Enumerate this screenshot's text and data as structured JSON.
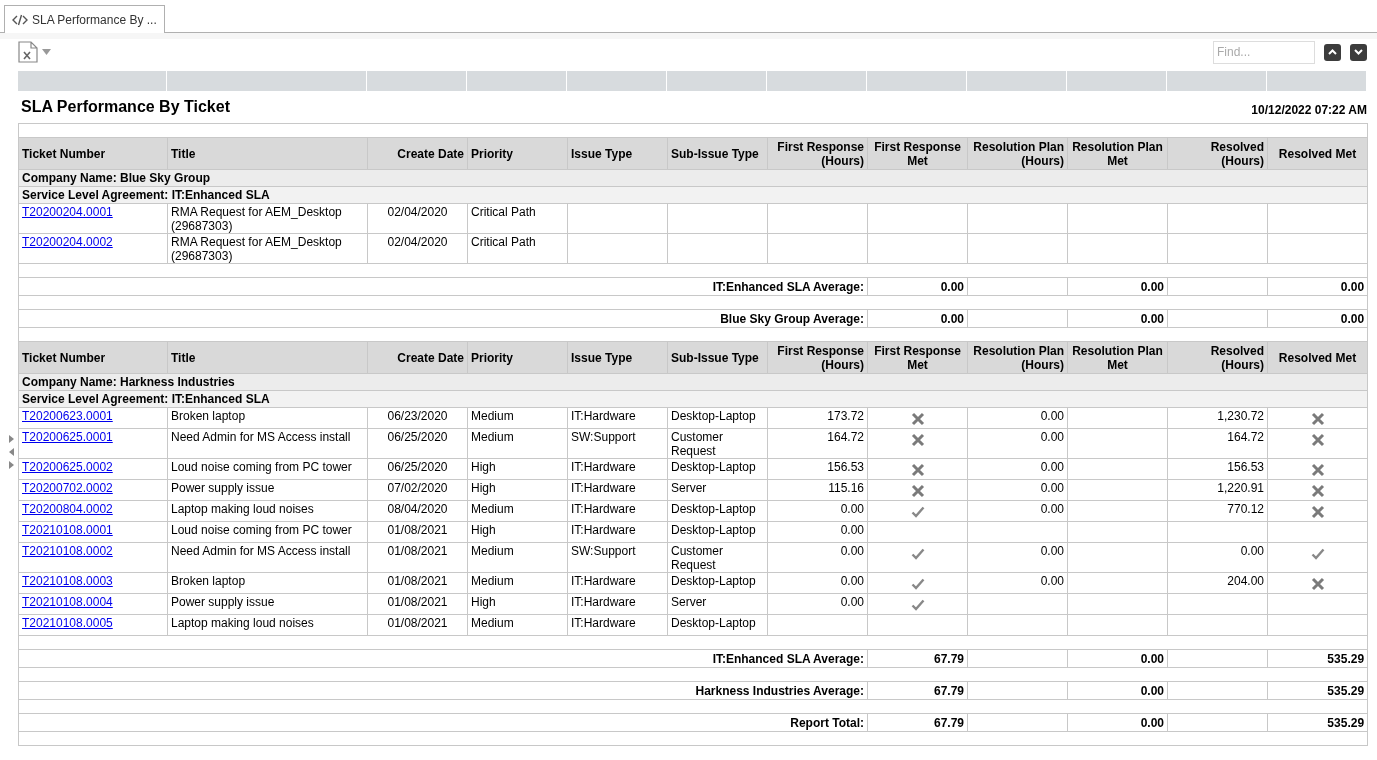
{
  "tab": {
    "label": "SLA Performance By ...",
    "selected": true
  },
  "find": {
    "placeholder": "Find..."
  },
  "report": {
    "title": "SLA Performance By Ticket",
    "timestamp": "10/12/2022 07:22 AM"
  },
  "sections": [
    {
      "columns": [
        "Ticket Number",
        "Title",
        "Create Date",
        "Priority",
        "Issue Type",
        "Sub-Issue Type",
        "First Response\n(Hours)",
        "First Response\nMet",
        "Resolution Plan\n(Hours)",
        "Resolution Plan\nMet",
        "Resolved\n(Hours)",
        "Resolved Met"
      ],
      "company": "Company Name: Blue Sky Group",
      "sla": "Service Level Agreement: IT:Enhanced SLA",
      "tickets": [
        {
          "number": "T20200204.0001",
          "title": "RMA Request for AEM_Desktop (29687303)",
          "date": "02/04/2020",
          "priority": "Critical Path"
        },
        {
          "number": "T20200204.0002",
          "title": "RMA Request for AEM_Desktop (29687303)",
          "date": "02/04/2020",
          "priority": "Critical Path"
        }
      ],
      "averages": [
        {
          "label": "IT:Enhanced SLA Average:",
          "first_response": "0.00",
          "resolution_plan": "0.00",
          "resolved": "0.00"
        },
        {
          "label": "Blue Sky Group Average:",
          "first_response": "0.00",
          "resolution_plan": "0.00",
          "resolved": "0.00"
        }
      ]
    },
    {
      "columns": [
        "Ticket Number",
        "Title",
        "Create Date",
        "Priority",
        "Issue Type",
        "Sub-Issue Type",
        "First Response\n(Hours)",
        "First Response\nMet",
        "Resolution Plan\n(Hours)",
        "Resolution Plan\nMet",
        "Resolved\n(Hours)",
        "Resolved Met"
      ],
      "company": "Company Name: Harkness Industries",
      "sla": "Service Level Agreement: IT:Enhanced SLA",
      "tickets": [
        {
          "number": "T20200623.0001",
          "title": "Broken laptop",
          "date": "06/23/2020",
          "priority": "Medium",
          "issue_type": "IT:Hardware",
          "sub_issue_type": "Desktop-Laptop",
          "first_response": "173.72",
          "first_response_met": false,
          "resolution_plan": "0.00",
          "resolved": "1,230.72",
          "resolved_met": false
        },
        {
          "number": "T20200625.0001",
          "title": "Need Admin for MS Access install",
          "date": "06/25/2020",
          "priority": "Medium",
          "issue_type": "SW:Support",
          "sub_issue_type": "Customer Request",
          "first_response": "164.72",
          "first_response_met": false,
          "resolution_plan": "0.00",
          "resolved": "164.72",
          "resolved_met": false
        },
        {
          "number": "T20200625.0002",
          "title": "Loud noise coming from PC tower",
          "date": "06/25/2020",
          "priority": "High",
          "issue_type": "IT:Hardware",
          "sub_issue_type": "Desktop-Laptop",
          "first_response": "156.53",
          "first_response_met": false,
          "resolution_plan": "0.00",
          "resolved": "156.53",
          "resolved_met": false
        },
        {
          "number": "T20200702.0002",
          "title": "Power supply issue",
          "date": "07/02/2020",
          "priority": "High",
          "issue_type": "IT:Hardware",
          "sub_issue_type": "Server",
          "first_response": "115.16",
          "first_response_met": false,
          "resolution_plan": "0.00",
          "resolved": "1,220.91",
          "resolved_met": false
        },
        {
          "number": "T20200804.0002",
          "title": "Laptop making loud noises",
          "date": "08/04/2020",
          "priority": "Medium",
          "issue_type": "IT:Hardware",
          "sub_issue_type": "Desktop-Laptop",
          "first_response": "0.00",
          "first_response_met": true,
          "resolution_plan": "0.00",
          "resolved": "770.12",
          "resolved_met": false
        },
        {
          "number": "T20210108.0001",
          "title": "Loud noise coming from PC tower",
          "date": "01/08/2021",
          "priority": "High",
          "issue_type": "IT:Hardware",
          "sub_issue_type": "Desktop-Laptop",
          "first_response": "0.00"
        },
        {
          "number": "T20210108.0002",
          "title": "Need Admin for MS Access install",
          "date": "01/08/2021",
          "priority": "Medium",
          "issue_type": "SW:Support",
          "sub_issue_type": "Customer Request",
          "first_response": "0.00",
          "first_response_met": true,
          "resolution_plan": "0.00",
          "resolved": "0.00",
          "resolved_met": true
        },
        {
          "number": "T20210108.0003",
          "title": "Broken laptop",
          "date": "01/08/2021",
          "priority": "Medium",
          "issue_type": "IT:Hardware",
          "sub_issue_type": "Desktop-Laptop",
          "first_response": "0.00",
          "first_response_met": true,
          "resolution_plan": "0.00",
          "resolved": "204.00",
          "resolved_met": false
        },
        {
          "number": "T20210108.0004",
          "title": "Power supply issue",
          "date": "01/08/2021",
          "priority": "High",
          "issue_type": "IT:Hardware",
          "sub_issue_type": "Server",
          "first_response": "0.00",
          "first_response_met": true
        },
        {
          "number": "T20210108.0005",
          "title": "Laptop making loud noises",
          "date": "01/08/2021",
          "priority": "Medium",
          "issue_type": "IT:Hardware",
          "sub_issue_type": "Desktop-Laptop"
        }
      ],
      "averages": [
        {
          "label": "IT:Enhanced SLA Average:",
          "first_response": "67.79",
          "resolution_plan": "0.00",
          "resolved": "535.29"
        },
        {
          "label": "Harkness Industries Average:",
          "first_response": "67.79",
          "resolution_plan": "0.00",
          "resolved": "535.29"
        }
      ]
    }
  ],
  "report_total": {
    "label": "Report Total:",
    "first_response": "67.79",
    "resolution_plan": "0.00",
    "resolved": "535.29"
  }
}
